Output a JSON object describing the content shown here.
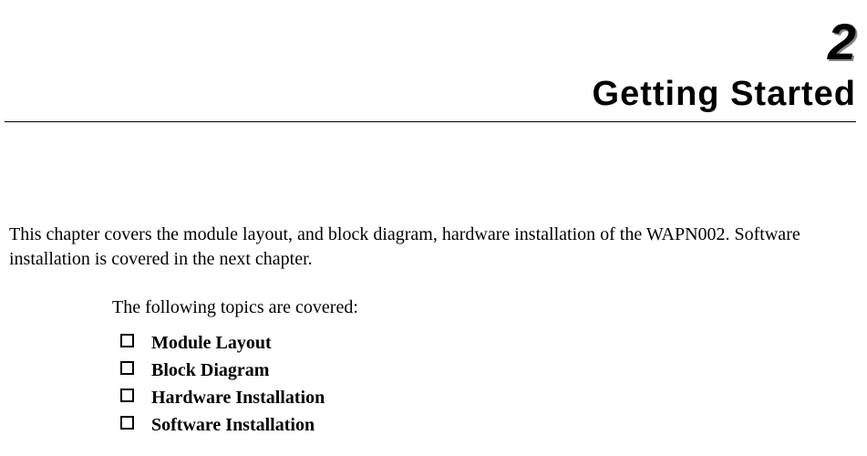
{
  "chapter": {
    "number": "2",
    "title": "Getting Started"
  },
  "intro_paragraph": "This chapter covers the module layout, and block diagram, hardware installation of the WAPN002. Software installation is covered in the next chapter.",
  "topics_intro": "The following topics are covered:",
  "topics": [
    {
      "label": "Module Layout"
    },
    {
      "label": "Block Diagram"
    },
    {
      "label": "Hardware Installation"
    },
    {
      "label": "Software Installation"
    }
  ]
}
